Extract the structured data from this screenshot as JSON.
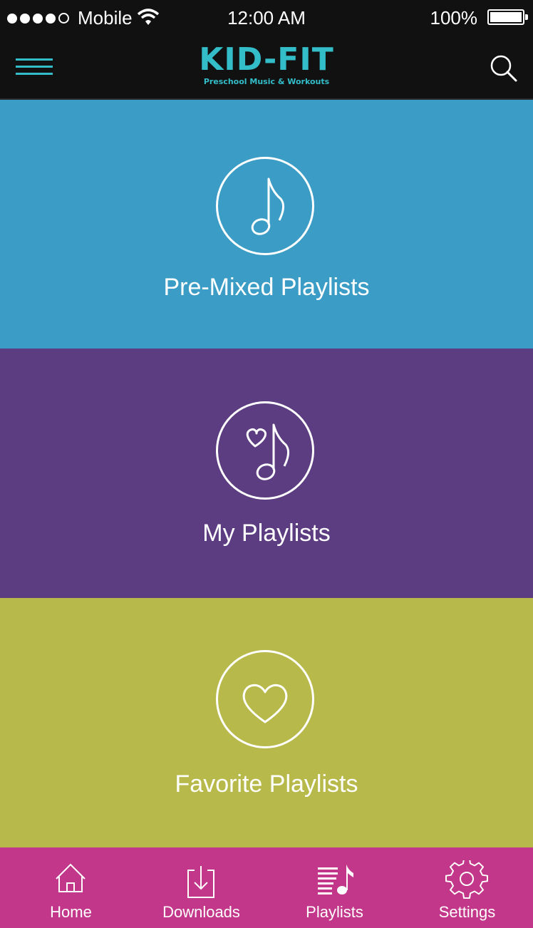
{
  "status_bar": {
    "carrier": "Mobile",
    "time": "12:00 AM",
    "battery": "100%",
    "signal_icons": [
      "signal-dot",
      "signal-dot",
      "signal-dot",
      "signal-dot",
      "signal-dot-empty"
    ]
  },
  "header": {
    "brand": "KID-FIT",
    "tagline": "Preschool Music & Workouts",
    "menu_icon": "hamburger-menu-icon",
    "search_icon": "search-icon"
  },
  "panels": [
    {
      "label": "Pre-Mixed Playlists",
      "icon": "music-note-icon",
      "color": "#3b9dc6"
    },
    {
      "label": "My Playlists",
      "icon": "heart-music-note-icon",
      "color": "#5d3d81"
    },
    {
      "label": "Favorite Playlists",
      "icon": "heart-icon",
      "color": "#b8b94b"
    }
  ],
  "tabs": [
    {
      "label": "Home",
      "icon": "home-icon"
    },
    {
      "label": "Downloads",
      "icon": "download-icon"
    },
    {
      "label": "Playlists",
      "icon": "playlist-icon"
    },
    {
      "label": "Settings",
      "icon": "gear-icon"
    }
  ],
  "colors": {
    "accent": "#33bdc8",
    "tabbar": "#c2378a",
    "header_bg": "#111111"
  }
}
